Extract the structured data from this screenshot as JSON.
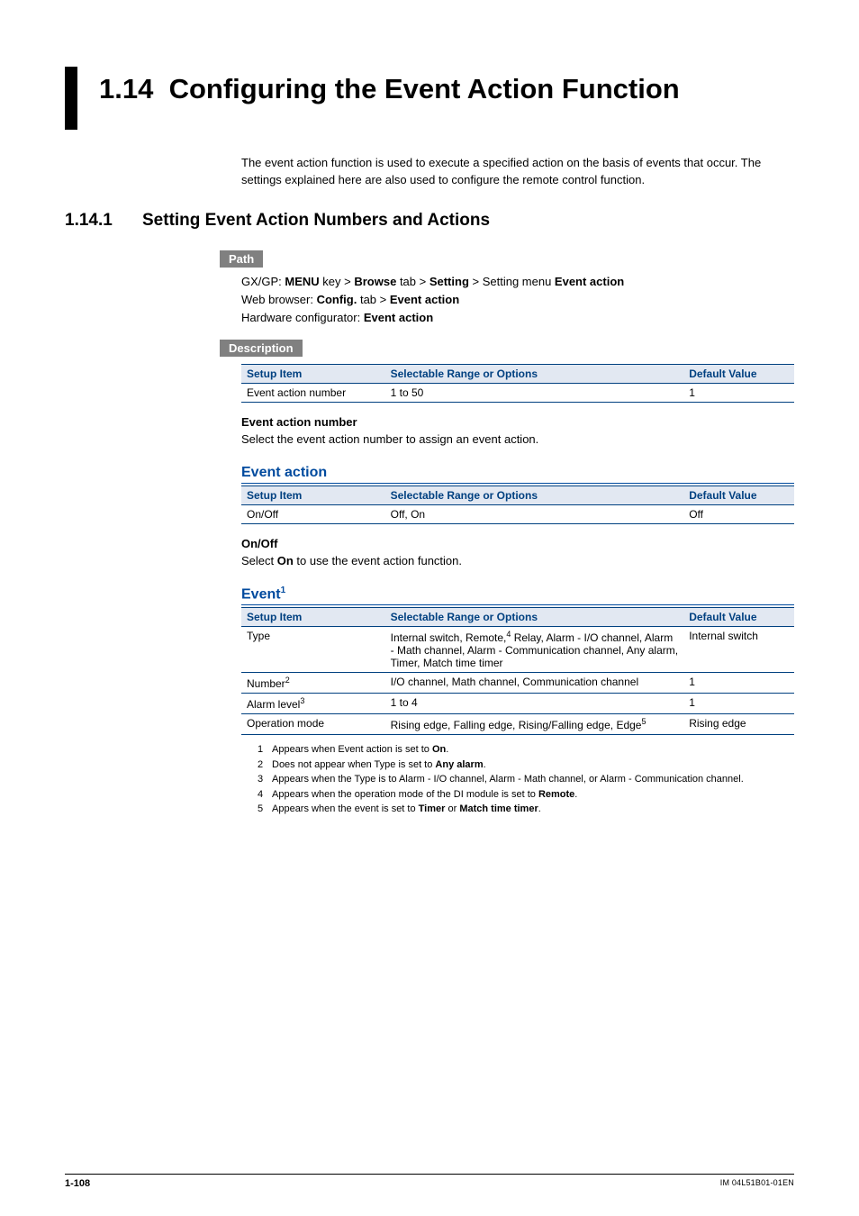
{
  "heading": {
    "number": "1.14",
    "title": "Configuring the Event Action Function"
  },
  "intro": "The event action function is used to execute a specified action on the basis of events that occur. The settings explained here are also used to configure the remote control function.",
  "subhead": {
    "number": "1.14.1",
    "title": "Setting Event Action Numbers and Actions"
  },
  "labels": {
    "path": "Path",
    "description": "Description"
  },
  "path": {
    "line1_prefix": "GX/GP: ",
    "line1_bold1": "MENU",
    "line1_mid1": " key > ",
    "line1_bold2": "Browse",
    "line1_mid2": " tab > ",
    "line1_bold3": "Setting",
    "line1_mid3": " > Setting menu ",
    "line1_bold4": "Event action",
    "line2_prefix": "Web browser: ",
    "line2_bold1": "Config.",
    "line2_mid1": " tab > ",
    "line2_bold2": "Event action",
    "line3_prefix": "Hardware configurator: ",
    "line3_bold1": "Event action"
  },
  "tbl_headers": {
    "c1": "Setup Item",
    "c2": "Selectable Range or Options",
    "c3": "Default Value"
  },
  "desc_table": {
    "r1c1": "Event action number",
    "r1c2": "1 to 50",
    "r1c3": "1"
  },
  "ean": {
    "head": "Event action number",
    "body": "Select the event action number to assign an event action."
  },
  "event_action_head": "Event action",
  "ea_table": {
    "r1c1": "On/Off",
    "r1c2": "Off, On",
    "r1c3": "Off"
  },
  "onoff": {
    "head": "On/Off",
    "body_pre": "Select ",
    "body_bold": "On",
    "body_post": " to use the event action function."
  },
  "event_head": "Event",
  "event_sup": "1",
  "event_table": {
    "r1c1": "Type",
    "r1c2a": "Internal switch, Remote,",
    "r1c2_sup": "4",
    "r1c2b": " Relay, Alarm - I/O channel, Alarm - Math channel, Alarm - Communication channel, Any alarm, Timer, Match time timer",
    "r1c3": "Internal switch",
    "r2c1": "Number",
    "r2sup": "2",
    "r2c2": "I/O channel, Math channel, Communication channel",
    "r2c3": "1",
    "r3c1": "Alarm level",
    "r3sup": "3",
    "r3c2": "1 to 4",
    "r3c3": "1",
    "r4c1": "Operation mode",
    "r4c2a": "Rising edge, Falling edge, Rising/Falling edge, Edge",
    "r4sup": "5",
    "r4c3": "Rising edge"
  },
  "footnotes": {
    "n1": "1",
    "t1a": "Appears when Event action is set to ",
    "t1b": "On",
    "t1c": ".",
    "n2": "2",
    "t2a": "Does not appear when Type is set to ",
    "t2b": "Any alarm",
    "t2c": ".",
    "n3": "3",
    "t3": "Appears when the Type is to Alarm - I/O channel, Alarm - Math channel, or Alarm - Communication channel.",
    "n4": "4",
    "t4a": "Appears when the operation mode of the DI module is set to ",
    "t4b": "Remote",
    "t4c": ".",
    "n5": "5",
    "t5a": "Appears when the event is set to ",
    "t5b": "Timer",
    "t5c": " or ",
    "t5d": "Match time timer",
    "t5e": "."
  },
  "footer": {
    "page": "1-108",
    "docid": "IM 04L51B01-01EN"
  }
}
